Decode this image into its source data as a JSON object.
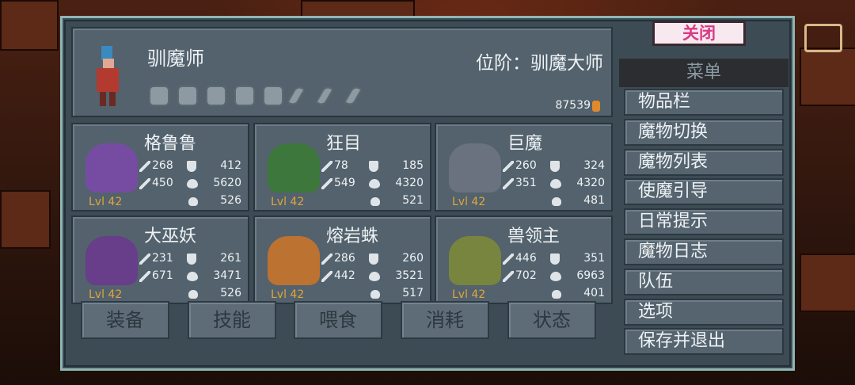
{
  "hero": {
    "name": "驯魔师",
    "rank": "位阶：驯魔大师",
    "gold": "87539"
  },
  "equipment_slots": [
    "boots-icon",
    "gloves-icon",
    "mushroom-icon",
    "amulet-icon",
    "ring-icon",
    "feather-icon",
    "feather-icon",
    "feather-icon"
  ],
  "monsters": [
    {
      "name": "格鲁鲁",
      "atk": "268",
      "def": "412",
      "mag": "450",
      "hp": "5620",
      "food": "526",
      "level": "Lvl 42",
      "color": "#7a4aa8"
    },
    {
      "name": "狂目",
      "atk": "78",
      "def": "185",
      "mag": "549",
      "hp": "4320",
      "food": "521",
      "level": "Lvl 42",
      "color": "#3b7a36"
    },
    {
      "name": "巨魔",
      "atk": "260",
      "def": "324",
      "mag": "351",
      "hp": "4320",
      "food": "481",
      "level": "Lvl 42",
      "color": "#6c7480"
    },
    {
      "name": "大巫妖",
      "atk": "231",
      "def": "261",
      "mag": "671",
      "hp": "3471",
      "food": "526",
      "level": "Lvl 42",
      "color": "#6a3a8c"
    },
    {
      "name": "熔岩蛛",
      "atk": "286",
      "def": "260",
      "mag": "442",
      "hp": "3521",
      "food": "517",
      "level": "Lvl 42",
      "color": "#c8742a"
    },
    {
      "name": "兽领主",
      "atk": "446",
      "def": "351",
      "mag": "702",
      "hp": "6963",
      "food": "401",
      "level": "Lvl 42",
      "color": "#7c8a3a"
    }
  ],
  "tabs": [
    "装备",
    "技能",
    "喂食",
    "消耗",
    "状态"
  ],
  "menu": {
    "close": "关闭",
    "title": "菜单",
    "items": [
      "物品栏",
      "魔物切换",
      "魔物列表",
      "使魔引导",
      "日常提示",
      "魔物日志",
      "队伍",
      "选项",
      "保存并退出"
    ]
  }
}
